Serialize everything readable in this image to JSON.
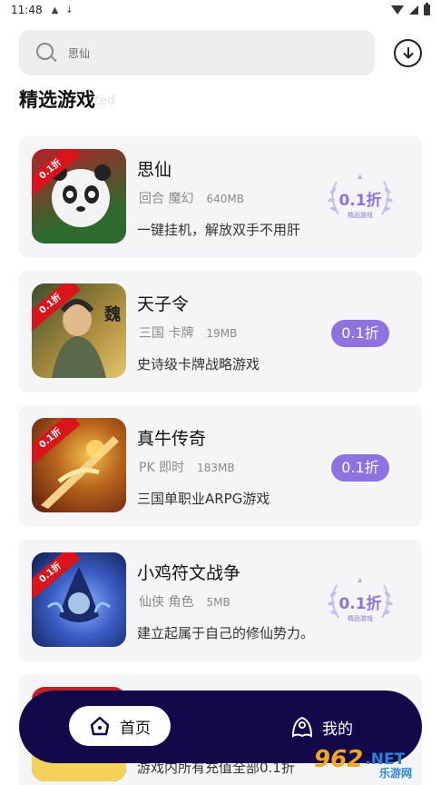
{
  "status_bar": {
    "time": "11:48",
    "icons": [
      "a-icon",
      "download-status-icon"
    ]
  },
  "search": {
    "placeholder": "思仙"
  },
  "section": {
    "title": "精选游戏",
    "ghost_text": "ted"
  },
  "games": [
    {
      "name": "思仙",
      "tags": "回合 魔幻",
      "size": "640MB",
      "desc": "一键挂机，解放双手不用肝",
      "badge_type": "laurel",
      "discount": "0.1折",
      "laurel_sub": "精品游戏",
      "icon_label": "0.1折",
      "icon_colors": [
        "#b4202a",
        "#2d6a2e"
      ]
    },
    {
      "name": "天子令",
      "tags": "三国 卡牌",
      "size": "19MB",
      "desc": "史诗级卡牌战略游戏",
      "badge_type": "pill",
      "discount": "0.1折",
      "icon_label": "0.1折",
      "icon_colors": [
        "#3a4e2a",
        "#a88a3e"
      ]
    },
    {
      "name": "真牛传奇",
      "tags": "PK 即时",
      "size": "183MB",
      "desc": "三国单职业ARPG游戏",
      "badge_type": "pill",
      "discount": "0.1折",
      "icon_label": "0.1折",
      "icon_colors": [
        "#b8651b",
        "#5b1a0c"
      ]
    },
    {
      "name": "小鸡符文战争",
      "tags": "仙侠 角色",
      "size": "5MB",
      "desc": "建立起属于自己的修仙势力。",
      "badge_type": "laurel",
      "discount": "0.1折",
      "laurel_sub": "精品游戏",
      "icon_label": "0.1折",
      "icon_colors": [
        "#1e3a8a",
        "#6b8ad8"
      ]
    },
    {
      "name": "",
      "tags": "",
      "size": "",
      "desc": "游戏内所有充值全部0.1折",
      "badge_type": "none",
      "discount": "",
      "icon_label": "",
      "icon_colors": [
        "#c2242a",
        "#2a2a2a"
      ]
    }
  ],
  "bottom_nav": {
    "home_label": "首页",
    "mine_label": "我的"
  },
  "watermark": {
    "num": "962",
    "net": ".NET",
    "sub": "乐游网"
  },
  "colors": {
    "accent": "#8d72e0",
    "nav_bg": "#12094a",
    "card_bg": "#f5f5f8"
  }
}
